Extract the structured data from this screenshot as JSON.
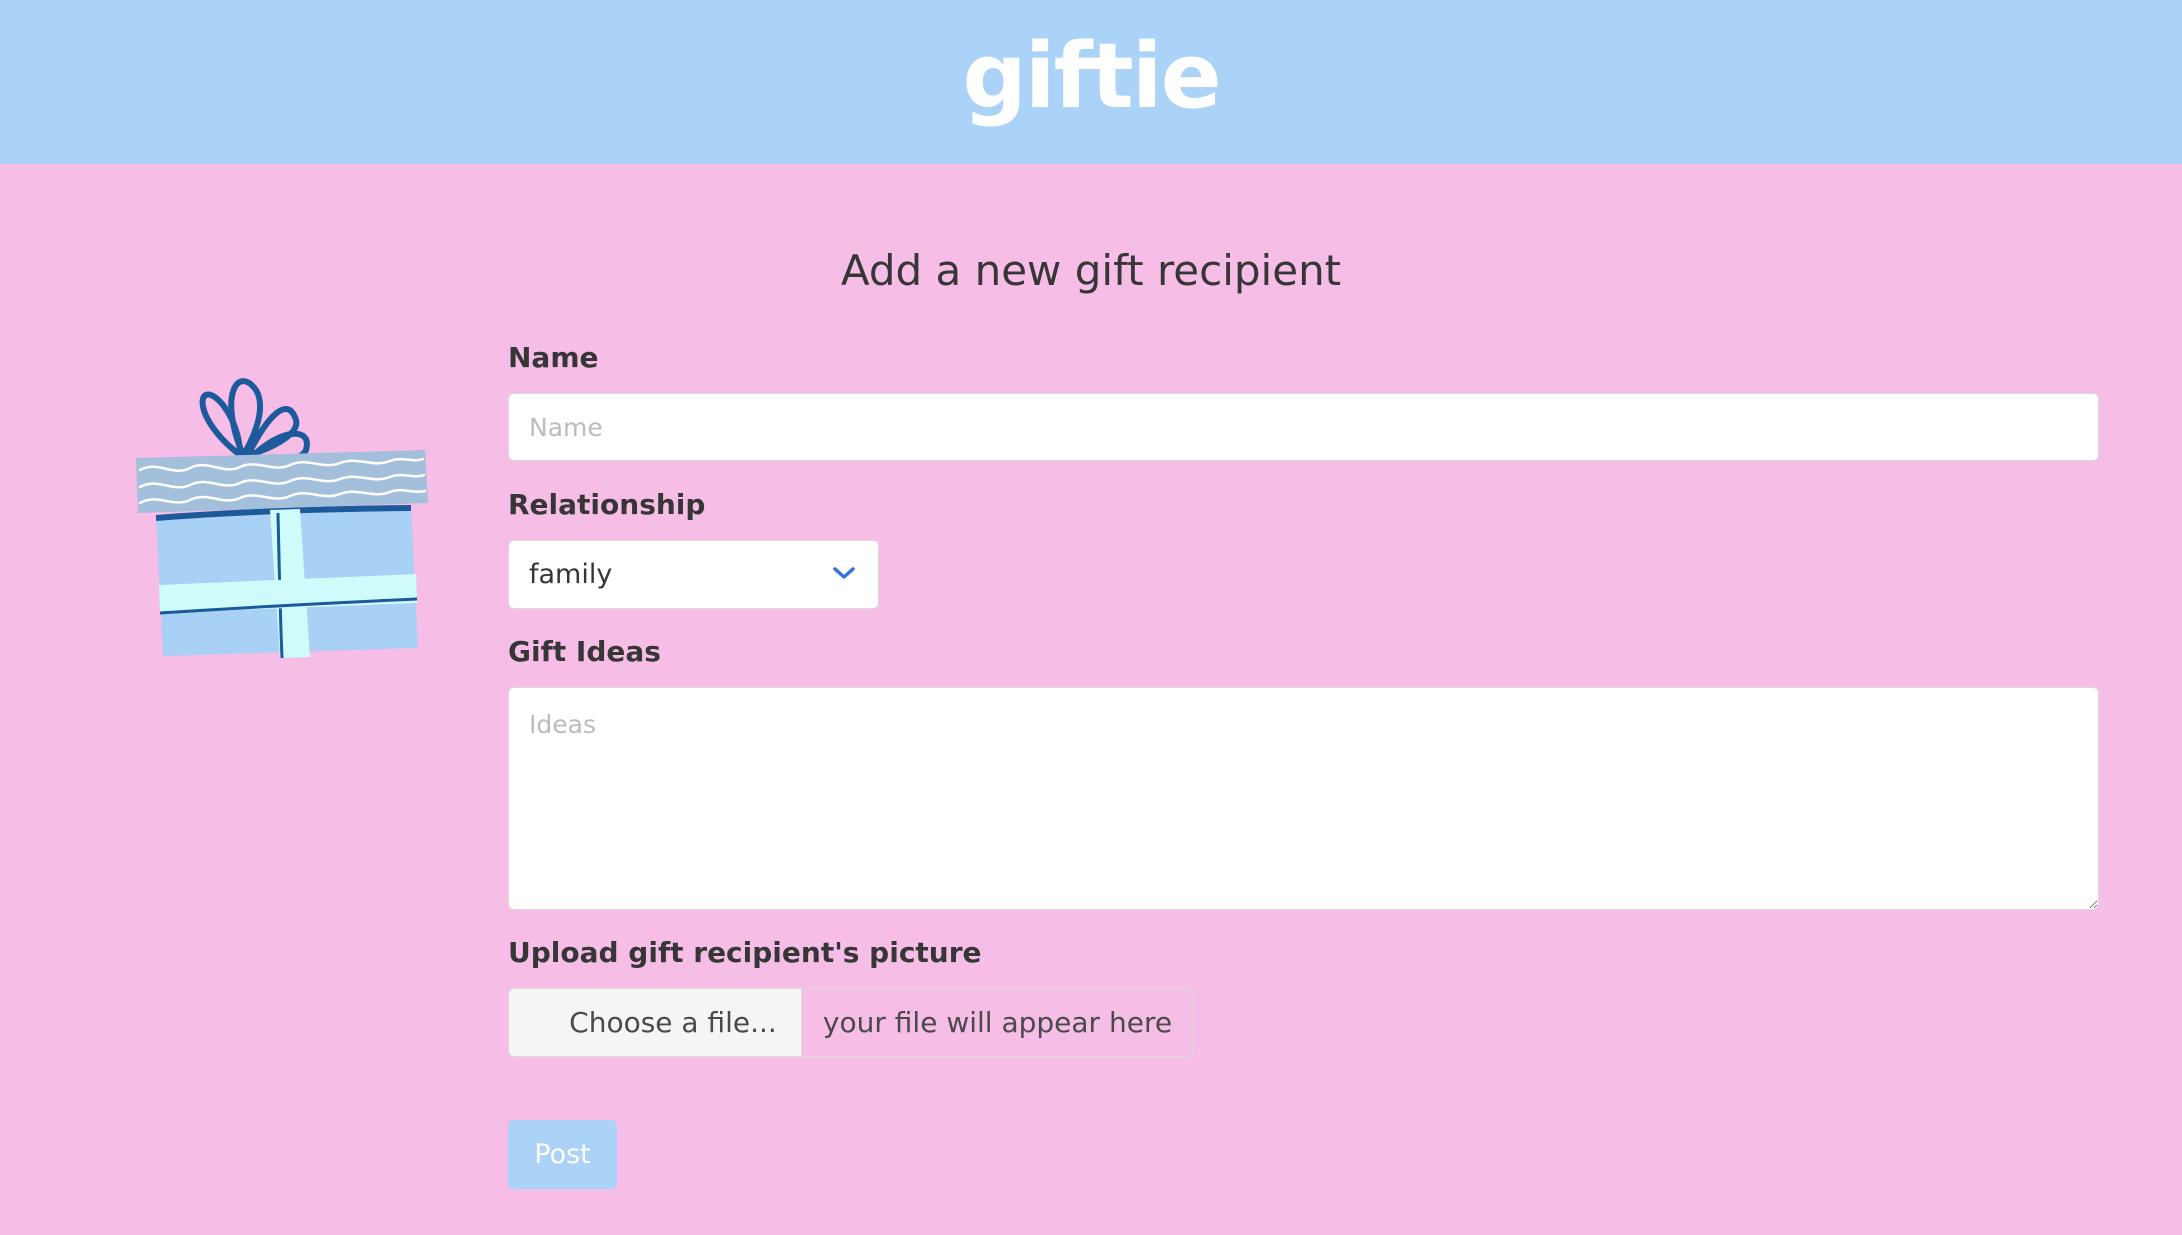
{
  "header": {
    "brand": "giftie"
  },
  "form": {
    "title": "Add a new gift recipient",
    "name": {
      "label": "Name",
      "placeholder": "Name",
      "value": ""
    },
    "relationship": {
      "label": "Relationship",
      "selected": "family"
    },
    "gift_ideas": {
      "label": "Gift Ideas",
      "placeholder": "Ideas",
      "value": ""
    },
    "upload": {
      "label": "Upload gift recipient's picture",
      "button_label": "Choose a file...",
      "file_name": "your file will appear here"
    },
    "submit_label": "Post"
  },
  "colors": {
    "header_bg": "#aad3f7",
    "page_bg": "#f6bde6",
    "text": "#363636",
    "chevron": "#3273dc",
    "gift_box": "#a9d0f5",
    "gift_lid": "#a3bfdc",
    "gift_ribbon": "#cffbfb",
    "gift_outline": "#1c5a9c"
  },
  "icons": {
    "select_arrow": "chevron-down-icon",
    "illustration": "gift-box-icon"
  }
}
